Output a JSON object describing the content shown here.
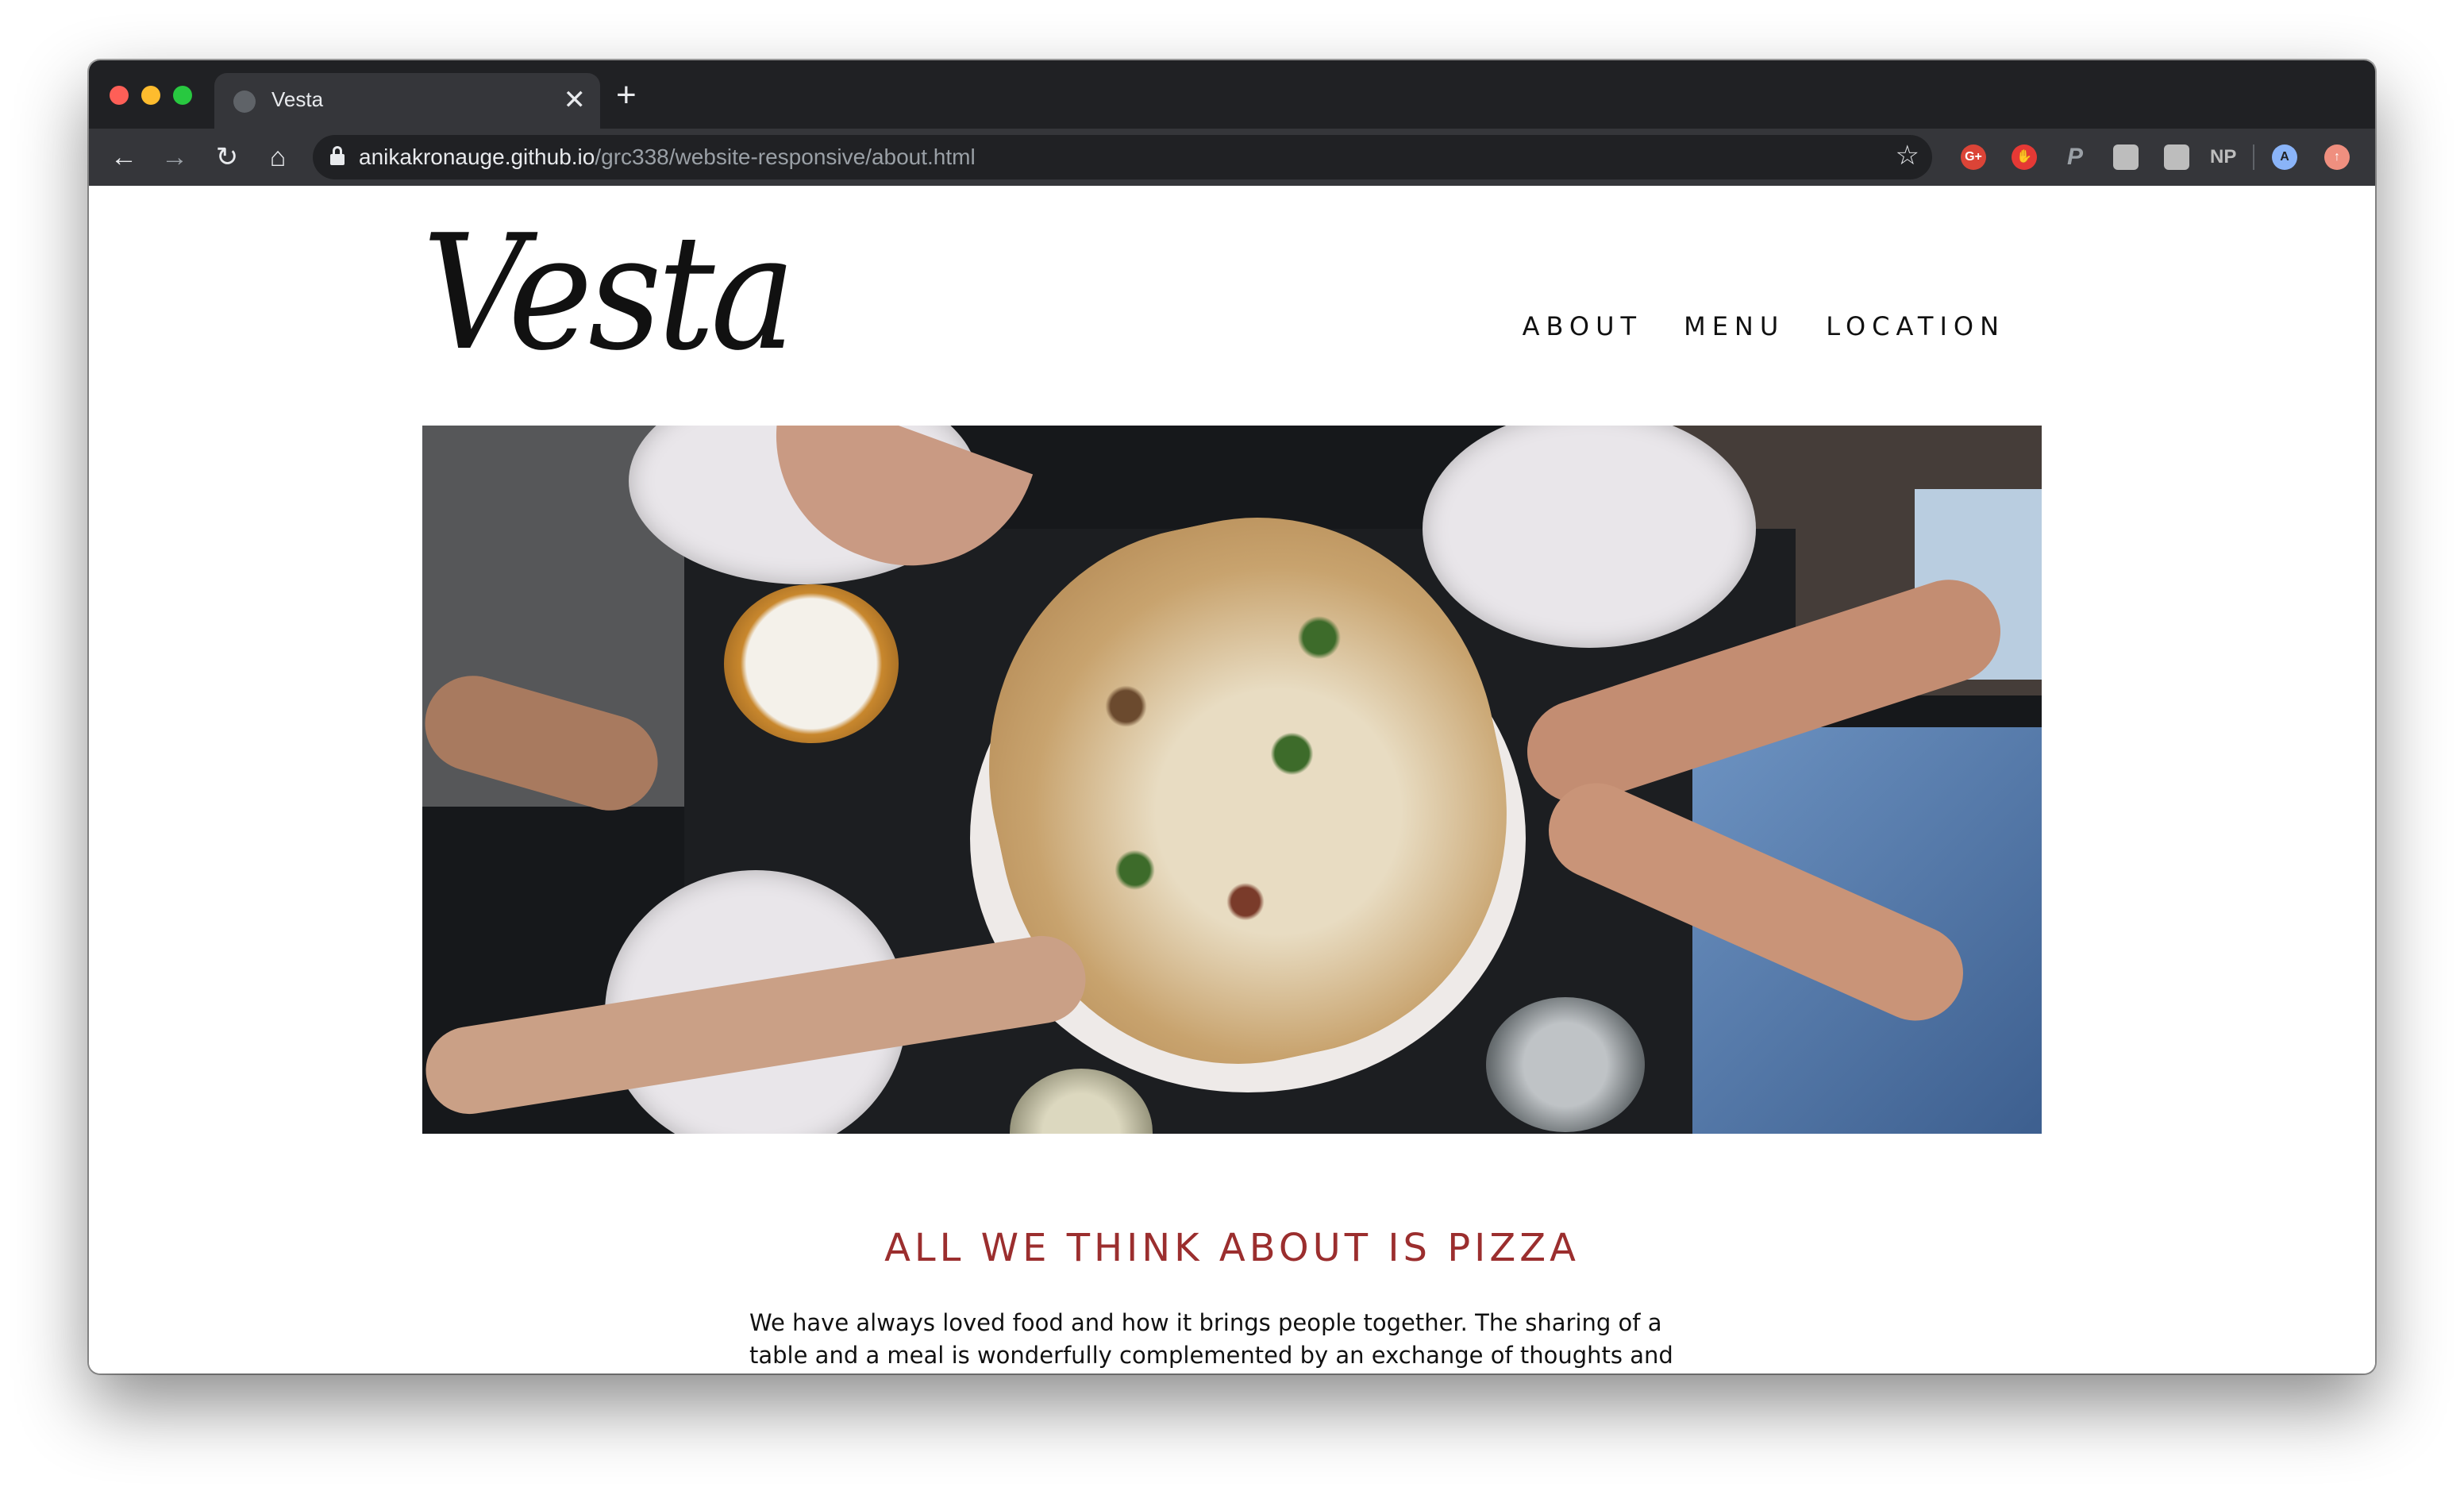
{
  "browser": {
    "tab_title": "Vesta",
    "tab_close_symbol": "✕",
    "new_tab_symbol": "+",
    "url_host": "anikakronauge.github.io",
    "url_path": "/grc338/website-responsive/about.html",
    "profile_initial": "A",
    "extensions": [
      "G+",
      "NP"
    ],
    "icons": [
      "back-arrow-icon",
      "forward-arrow-icon",
      "reload-icon",
      "home-icon",
      "lock-icon",
      "star-icon"
    ]
  },
  "site": {
    "logo": "Vesta",
    "nav": [
      "ABOUT",
      "MENU",
      "LOCATION"
    ],
    "hero_alt": "",
    "heading": "ALL WE THINK ABOUT IS PIZZA",
    "paragraph": "We have always loved food and how it brings people together. The sharing of a table and a meal is wonderfully complemented by an exchange of thoughts and ideas. And this food that we share is so important. Where it comes from, how it was grown or treated, and how it was"
  },
  "colors": {
    "accent": "#9b2e2e",
    "chrome_dark": "#202124",
    "chrome_mid": "#35363a"
  }
}
